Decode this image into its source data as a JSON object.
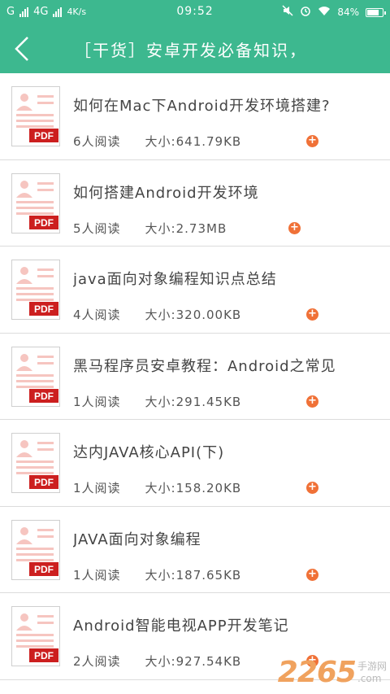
{
  "status_bar": {
    "carrier": "G",
    "network": "4G",
    "speed": "4K/s",
    "time": "09:52",
    "battery": "84%"
  },
  "header": {
    "title": "［干货］安卓开发必备知识，"
  },
  "items": [
    {
      "title": "如何在Mac下Android开发环境搭建?",
      "readers": "6人阅读",
      "size": "大小:641.79KB",
      "action": "+"
    },
    {
      "title": "如何搭建Android开发环境",
      "readers": "5人阅读",
      "size": "大小:2.73MB",
      "action": "+"
    },
    {
      "title": "java面向对象编程知识点总结",
      "readers": "4人阅读",
      "size": "大小:320.00KB",
      "action": "+"
    },
    {
      "title": "黑马程序员安卓教程：Android之常见",
      "readers": "1人阅读",
      "size": "大小:291.45KB",
      "action": "+"
    },
    {
      "title": "达内JAVA核心API(下)",
      "readers": "1人阅读",
      "size": "大小:158.20KB",
      "action": "+"
    },
    {
      "title": "JAVA面向对象编程",
      "readers": "1人阅读",
      "size": "大小:187.65KB",
      "action": "+"
    },
    {
      "title": "Android智能电视APP开发笔记",
      "readers": "2人阅读",
      "size": "大小:927.54KB",
      "action": "+"
    }
  ],
  "pdf_label": "PDF",
  "watermark": {
    "number": "2265",
    "suffix": ".com",
    "site": "手游网"
  },
  "colors": {
    "accent": "#3db88f",
    "pdf_red": "#cc1f1f",
    "add_orange": "#f07137"
  }
}
